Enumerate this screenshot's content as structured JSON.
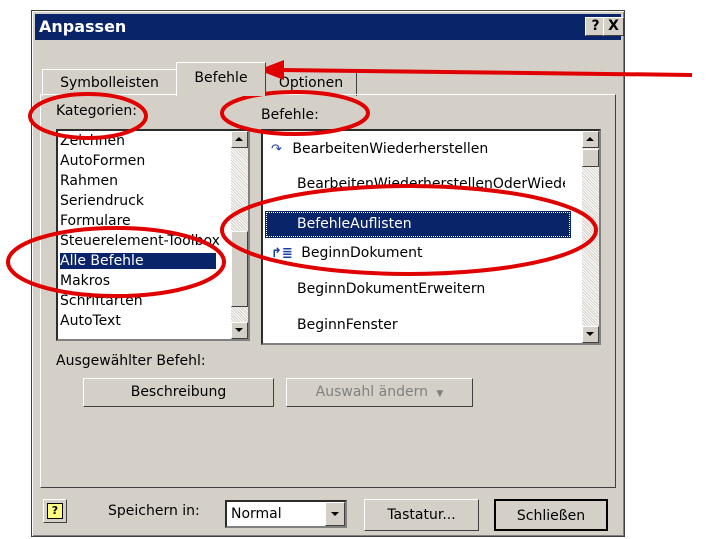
{
  "dialog": {
    "title": "Anpassen",
    "help_btn": "?",
    "close_btn": "X"
  },
  "tabs": [
    {
      "label": "Symbolleisten"
    },
    {
      "label": "Befehle"
    },
    {
      "label": "Optionen"
    }
  ],
  "categories": {
    "label": "Kategorien:",
    "items": [
      "Zeichnen",
      "AutoFormen",
      "Rahmen",
      "Seriendruck",
      "Formulare",
      "Steuerelement-Toolbox",
      "Alle Befehle",
      "Makros",
      "Schriftarten",
      "AutoText"
    ],
    "selected": "Alle Befehle"
  },
  "commands": {
    "label": "Befehle:",
    "items": [
      "BearbeitenWiederherstellen",
      "BearbeitenWiederherstellenOderWiederholen",
      "BefehleAuflisten",
      "BeginnDokument",
      "BeginnDokumentErweitern",
      "BeginnFenster"
    ],
    "selected": "BefehleAuflisten"
  },
  "selected_command": {
    "label": "Ausgewählter Befehl:",
    "description_btn": "Beschreibung",
    "modify_btn": "Auswahl ändern"
  },
  "footer": {
    "save_in_label": "Speichern in:",
    "save_in_value": "Normal",
    "keyboard_btn": "Tastatur...",
    "close_btn": "Schließen"
  },
  "annotation_color": "#e00000",
  "icons": [
    "help-icon",
    "redo-icon",
    "list-icon",
    "dropdown-arrow-icon"
  ]
}
